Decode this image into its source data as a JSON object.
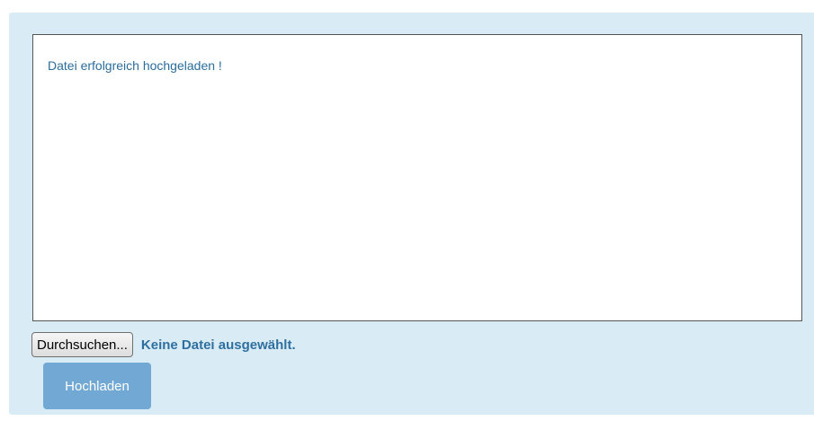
{
  "message": {
    "text": "Datei erfolgreich hochgeladen !"
  },
  "file_input": {
    "browse_label": "Durchsuchen...",
    "status": "Keine Datei ausgewählt."
  },
  "upload": {
    "label": "Hochladen"
  },
  "colors": {
    "panel_background": "#d9ecf6",
    "message_text": "#2a6d9c",
    "upload_button": "#72a9d4"
  }
}
